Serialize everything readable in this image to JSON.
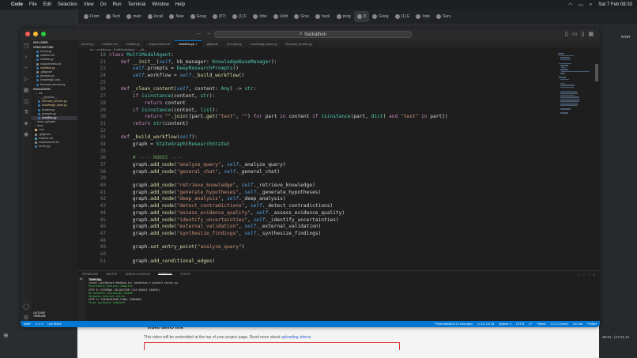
{
  "menubar": {
    "app": "Code",
    "items": [
      "File",
      "Edit",
      "Selection",
      "View",
      "Go",
      "Run",
      "Terminal",
      "Window",
      "Help"
    ],
    "clock": "Sat 7 Feb 08:33"
  },
  "browser": {
    "tabs": [
      "From",
      "Tech",
      "main",
      "locali",
      "New",
      "Goog",
      "(97)",
      "(1) F",
      "Inbo",
      "Untit",
      "Grov",
      "hack",
      "prog",
      "D",
      "Goog",
      "(1) E",
      "Inde",
      "Surv"
    ],
    "right_label": "erver",
    "side_time": "26-01...(17.01.41",
    "video_title": "* Video demo link",
    "video_text": "This video will be embedded at the top of your project page. Read more about",
    "video_link": "uploading videos"
  },
  "vscode": {
    "search": "hackathon",
    "editor_tabs": [
      {
        "label": "server.py",
        "active": false
      },
      {
        "label": "readme.md",
        "active": false
      },
      {
        "label": "models.py",
        "active": false
      },
      {
        "label": "requirements.txt",
        "active": false
      },
      {
        "label": "workflow.py",
        "active": true
      },
      {
        "label": ".gitignore",
        "active": false
      },
      {
        "label": "prompts.py",
        "active": false
      },
      {
        "label": "knowledge_base.py",
        "active": false
      },
      {
        "label": "firecrawl_service.py",
        "active": false
      }
    ],
    "breadcrumbs": "src › workflow.py › MultiModalAgent › __init__",
    "sidebar": {
      "explorer": "EXPLORER",
      "open_editors": "OPEN EDITORS",
      "open_files": [
        "server.py",
        "readme.md",
        "models.py",
        "requirements.txt",
        "workflow.py",
        "prompts.py",
        ".gitignore",
        "prompts.py",
        "knowledge_bas...",
        "firecrawl_service.py"
      ],
      "project": "HACKATHON",
      "tree": [
        "src",
        "__pycache__",
        "firecrawl_service.py",
        "knowledge_base.py",
        "models.py",
        "prompts.py",
        "workflow.py",
        "temp_uploads",
        "venv",
        ".env",
        ".gitignore",
        "readme.md",
        "requirements.txt",
        "server.py"
      ],
      "outline": "OUTLINE",
      "timeline": "TIMELINE"
    },
    "code_lines": [
      {
        "n": "18",
        "t": "class MultiModalAgent:"
      },
      {
        "n": "21",
        "t": "    def __init__(self, kb_manager: KnowledgeBaseManager):"
      },
      {
        "n": "23",
        "t": "        self.prompts = DeepResearchPrompts()"
      },
      {
        "n": "24",
        "t": "        self.workflow = self._build_workflow()"
      },
      {
        "n": "25",
        "t": ""
      },
      {
        "n": "26",
        "t": "    def _clean_content(self, content: Any) -> str:"
      },
      {
        "n": "27",
        "t": "        if isinstance(content, str):"
      },
      {
        "n": "28",
        "t": "            return content"
      },
      {
        "n": "29",
        "t": "        if isinstance(content, list):"
      },
      {
        "n": "30",
        "t": "            return \"\".join([part.get(\"text\", \"\") for part in content if isinstance(part, dict) and \"text\" in part])"
      },
      {
        "n": "31",
        "t": "        return str(content)"
      },
      {
        "n": "32",
        "t": ""
      },
      {
        "n": "33",
        "t": "    def _build_workflow(self):"
      },
      {
        "n": "34",
        "t": "        graph = StateGraph(ResearchState)"
      },
      {
        "n": "35",
        "t": ""
      },
      {
        "n": "36",
        "t": "        # ---- NODES ----"
      },
      {
        "n": "37",
        "t": "        graph.add_node(\"analyze_query\", self._analyze_query)"
      },
      {
        "n": "38",
        "t": "        graph.add_node(\"general_chat\", self._general_chat)"
      },
      {
        "n": "39",
        "t": ""
      },
      {
        "n": "40",
        "t": "        graph.add_node(\"retrieve_knowledge\", self._retrieve_knowledge)"
      },
      {
        "n": "41",
        "t": "        graph.add_node(\"generate_hypotheses\", self._generate_hypotheses)"
      },
      {
        "n": "42",
        "t": "        graph.add_node(\"deep_analysis\", self._deep_analysis)"
      },
      {
        "n": "43",
        "t": "        graph.add_node(\"detect_contradictions\", self._detect_contradictions)"
      },
      {
        "n": "44",
        "t": "        graph.add_node(\"assess_evidence_quality\", self._assess_evidence_quality)"
      },
      {
        "n": "45",
        "t": "        graph.add_node(\"identify_uncertainties\", self._identify_uncertainties)"
      },
      {
        "n": "46",
        "t": "        graph.add_node(\"external_validation\", self._external_validation)"
      },
      {
        "n": "47",
        "t": "        graph.add_node(\"synthesize_findings\", self._synthesize_findings)"
      },
      {
        "n": "48",
        "t": ""
      },
      {
        "n": "49",
        "t": "        graph.set_entry_point(\"analyze_query\")"
      },
      {
        "n": "50",
        "t": ""
      },
      {
        "n": "51",
        "t": "        graph.add_conditional_edges("
      }
    ],
    "panel_tabs": [
      "PROBLEMS",
      "OUTPUT",
      "DEBUG CONSOLE",
      "TERMINAL",
      "PORTS"
    ],
    "terminal": {
      "header": "TERMINAL",
      "lines": [
        "(venv) user@Users-MacBook-Air hackathon % python3 server.py",
        "  Uncertainty analysis complete",
        "",
        "STEP 8: EXTERNAL VALIDATION (VIA GOOGLE SEARCH)",
        "  No external validation needed",
        "  Skipping external search",
        "",
        "STEP 9: SYNTHESIZING FINAL FINDINGS",
        "  Final synthesis complete"
      ]
    },
    "status": {
      "branch": "main*",
      "errors": "0 ⚠ 0",
      "live": "Live Share",
      "right": [
        "Prince.ashok(11:13 mins ago)",
        "Ln 18, Col 28",
        "Spaces: 4",
        "UTF-8",
        "LF",
        "Python",
        "3.12.0 ('venv')",
        "Go Live",
        "Prettier"
      ]
    }
  }
}
